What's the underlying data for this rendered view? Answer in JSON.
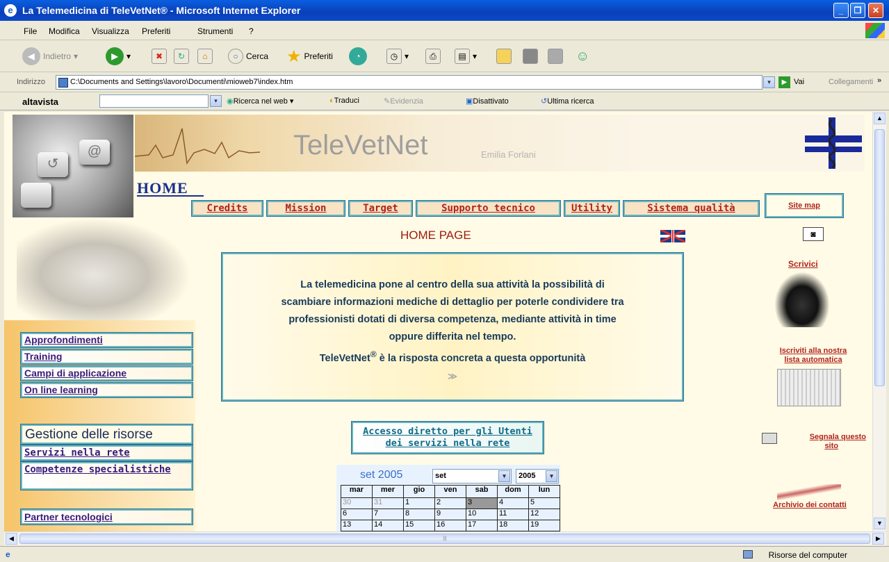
{
  "window": {
    "title": "La Telemedicina di TeleVetNet® - Microsoft Internet Explorer"
  },
  "menu": [
    "File",
    "Modifica",
    "Visualizza",
    "Preferiti",
    "Strumenti",
    "?"
  ],
  "toolbar": {
    "back": "Indietro",
    "search": "Cerca",
    "favorites": "Preferiti"
  },
  "address": {
    "label": "Indirizzo",
    "url": "C:\\Documents and Settings\\lavoro\\Documenti\\mioweb7\\index.htm",
    "go": "Vai",
    "links": "Collegamenti"
  },
  "altavista": {
    "logo": "altavista",
    "search_web": "Ricerca nel web",
    "translate": "Traduci",
    "highlight": "Evidenzia",
    "disabled": "Disattivato",
    "last_search": "Ultima ricerca"
  },
  "page": {
    "brand": "TeleVetNet",
    "author": "Emilia Forlani",
    "home": "HOME",
    "nav": [
      "Credits",
      "Mission",
      "Target",
      "Supporto tecnico",
      "Utility",
      "Sistema qualità"
    ],
    "sitemap": "Site map",
    "homepage": "HOME PAGE",
    "intro_line1": "La telemedicina pone al centro della sua attività la possibilità di",
    "intro_line2": "scambiare informazioni mediche di dettaglio per poterle condividere tra",
    "intro_line3": "professionisti dotati di diversa competenza, mediante attività in time",
    "intro_line4": "oppure differita nel tempo.",
    "intro_line5_a": "TeleVetNet",
    "intro_line5_sup": "®",
    "intro_line5_b": " è la risposta concreta a questa opportunità",
    "more": "≫",
    "left_links": [
      "Approfondimenti",
      "Training",
      "Campi di applicazione",
      "On line learning"
    ],
    "gestione": "Gestione delle risorse",
    "servizi": "Servizi nella rete",
    "competenze": "Competenze specialistiche",
    "partner": "Partner tecnologici",
    "accesso_line1": "Accesso diretto per gli Utenti",
    "accesso_line2": "dei servizi nella rete",
    "scrivici": "Scrivici",
    "iscriviti_line1": "Iscriviti alla nostra",
    "iscriviti_line2": "lista automatica",
    "segnala_line1": "Segnala questo",
    "segnala_line2": "sito",
    "archivio": "Archivio dei contatti"
  },
  "calendar": {
    "header": "set 2005",
    "month_sel": "set",
    "year_sel": "2005",
    "days": [
      "mar",
      "mer",
      "gio",
      "ven",
      "sab",
      "dom",
      "lun"
    ],
    "rows": [
      [
        "30",
        "31",
        "1",
        "2",
        "3",
        "4",
        "5"
      ],
      [
        "6",
        "7",
        "8",
        "9",
        "10",
        "11",
        "12"
      ],
      [
        "13",
        "14",
        "15",
        "16",
        "17",
        "18",
        "19"
      ]
    ]
  },
  "status": {
    "zone": "Risorse del computer"
  }
}
